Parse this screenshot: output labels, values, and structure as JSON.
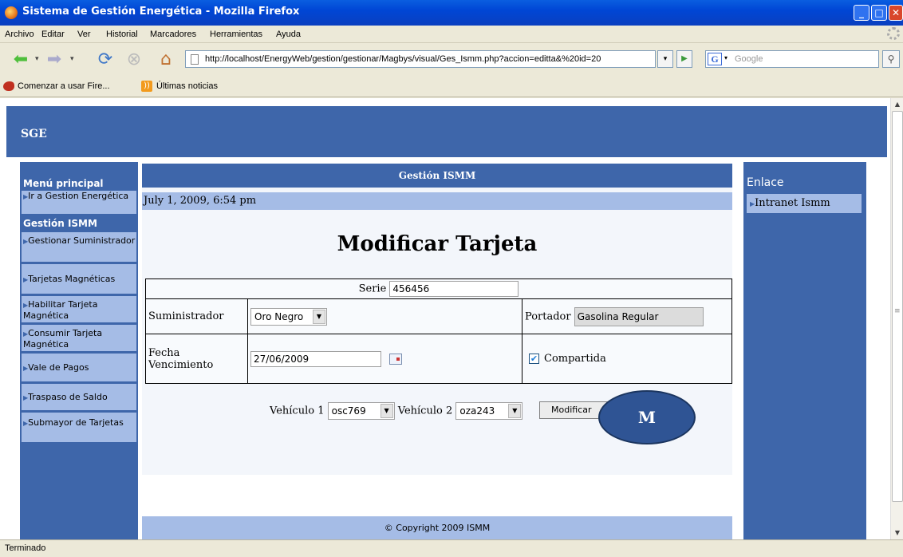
{
  "window": {
    "title": "Sistema de Gestión Energética - Mozilla Firefox"
  },
  "menu": [
    "Archivo",
    "Editar",
    "Ver",
    "Historial",
    "Marcadores",
    "Herramientas",
    "Ayuda"
  ],
  "toolbar": {
    "url": "http://localhost/EnergyWeb/gestion/gestionar/Magbys/visual/Ges_Ismm.php?accion=editta&%20id=20",
    "search_placeholder": "Google"
  },
  "bookmarks": [
    "Comenzar a usar Fire...",
    "Últimas noticias"
  ],
  "site": {
    "brand": "SGE",
    "center_header": "Gestión ISMM",
    "date": "July 1, 2009, 6:54 pm",
    "footer": "© Copyright 2009 ISMM"
  },
  "leftnav": {
    "heading_main": "Menú principal",
    "heading_ismm": "Gestión ISMM",
    "items": [
      "Ir a Gestion Energética",
      "Gestionar Suministrador",
      "Tarjetas Magnéticas",
      "Habilitar Tarjeta Magnética",
      "Consumir Tarjeta Magnética",
      "Vale de Pagos",
      "Traspaso de Saldo",
      "Submayor de Tarjetas"
    ]
  },
  "rightnav": {
    "heading": "Enlace",
    "items": [
      "Intranet Ismm"
    ]
  },
  "form": {
    "title": "Modificar Tarjeta",
    "serie_label": "Serie",
    "serie_value": "456456",
    "suministrador_label": "Suministrador",
    "suministrador_value": "Oro Negro",
    "portador_label": "Portador",
    "portador_value": "Gasolina Regular",
    "fecha_label": "Fecha Vencimiento",
    "fecha_value": "27/06/2009",
    "compartida_label": "Compartida",
    "compartida_checked": true,
    "vehiculo1_label": "Vehículo 1",
    "vehiculo1_value": "osc769",
    "vehiculo2_label": "Vehículo 2",
    "vehiculo2_value": "oza243",
    "submit_label": "Modificar"
  },
  "annotation": {
    "label": "M"
  },
  "status": {
    "text": "Terminado"
  }
}
